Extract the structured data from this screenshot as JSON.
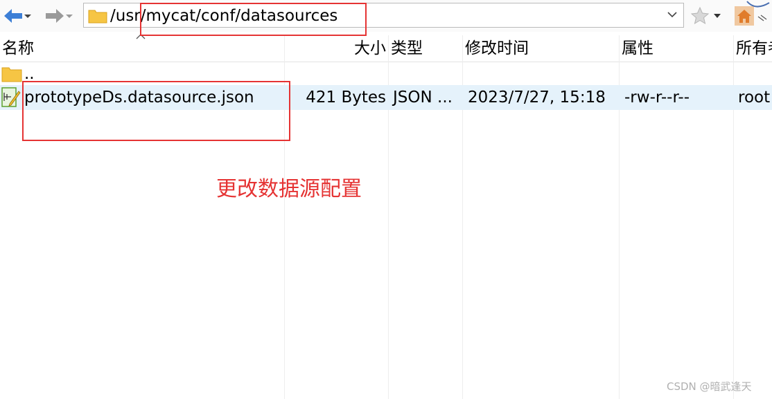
{
  "toolbar": {
    "address": "/usr/mycat/conf/datasources",
    "icons": [
      "back-arrow-icon",
      "forward-arrow-icon",
      "folder-icon",
      "chevron-down-icon",
      "star-icon",
      "home-icon"
    ]
  },
  "columns": [
    {
      "label": "名称"
    },
    {
      "label": "大小"
    },
    {
      "label": "类型"
    },
    {
      "label": "修改时间"
    },
    {
      "label": "属性"
    },
    {
      "label": "所有者"
    }
  ],
  "rows": [
    {
      "name": "..",
      "size": "",
      "type": "",
      "modified": "",
      "attrs": "",
      "owner": ""
    },
    {
      "name": "prototypeDs.datasource.json",
      "size": "421 Bytes",
      "type": "JSON ...",
      "modified": "2023/7/27, 15:18",
      "attrs": "-rw-r--r--",
      "owner": "root"
    }
  ],
  "annotation": {
    "note": "更改数据源配置"
  },
  "watermark": "CSDN @暗武逢天",
  "colors": {
    "annotation_red": "#e53333",
    "selection": "#e5f2fb",
    "arrow_blue": "#3d7fd6"
  }
}
